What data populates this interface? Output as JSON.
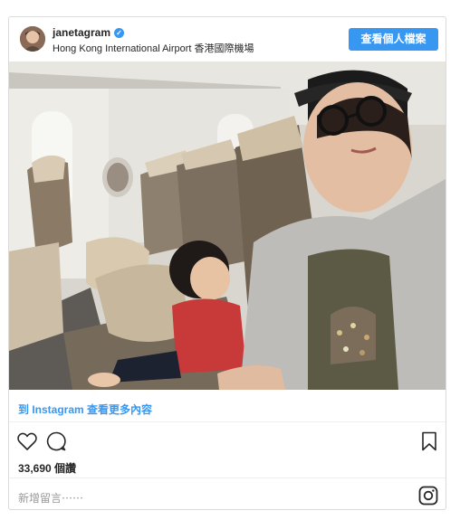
{
  "post": {
    "username": "janetagram",
    "verified_mark": "✓",
    "location": "Hong Kong International Airport 香港國際機場",
    "profile_button": "查看個人檔案",
    "photo_icon": "photo-airplane-selfie",
    "instagram_link": "到 Instagram 查看更多內容",
    "likes": "33,690 個讚",
    "comment_placeholder": "新增留言⋯⋯"
  },
  "icons": {
    "like": "heart-icon",
    "comment": "comment-bubble-icon",
    "save": "bookmark-icon",
    "brand": "instagram-logo-icon"
  },
  "colors": {
    "accent": "#3897f0",
    "text": "#262626",
    "border": "#dbdbdb"
  }
}
